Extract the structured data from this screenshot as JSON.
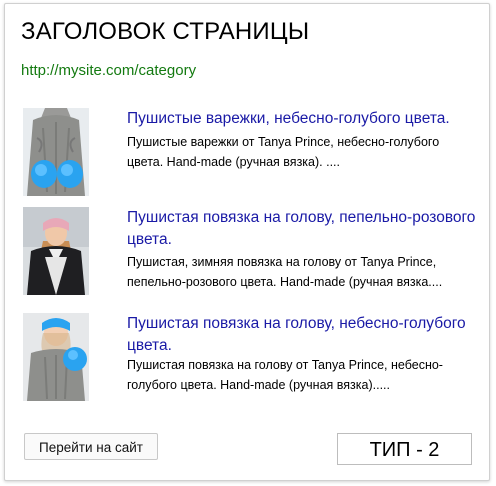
{
  "header": {
    "title": "ЗАГОЛОВОК СТРАНИЦЫ",
    "url": "http://mysite.com/category"
  },
  "items": [
    {
      "title": "Пушистые варежки, небесно-голубого цвета.",
      "description": "Пушистые варежки от Tanya Prince, небесно-голубого цвета. Hand-made (ручная вязка). ....",
      "image_icon": "woman-blue-mittens-photo"
    },
    {
      "title": "Пушистая повязка на голову, пепельно-розового цвета.",
      "description": "Пушистая, зимняя повязка на голову от Tanya Prince, пепельно-розового цвета. Hand-made (ручная вязка....",
      "image_icon": "woman-pink-headband-photo"
    },
    {
      "title": "Пушистая повязка на голову, небесно-голубого цвета.",
      "description": "Пушистая повязка на голову от Tanya Prince, небесно-голубого цвета. Hand-made (ручная вязка).....",
      "image_icon": "woman-blue-headband-photo"
    }
  ],
  "footer": {
    "visit_label": "Перейти на сайт",
    "type_label": "ТИП - 2"
  },
  "colors": {
    "title_link": "#1a1aa6",
    "url_green": "#137a10",
    "accent_blue": "#2aa3f0"
  }
}
